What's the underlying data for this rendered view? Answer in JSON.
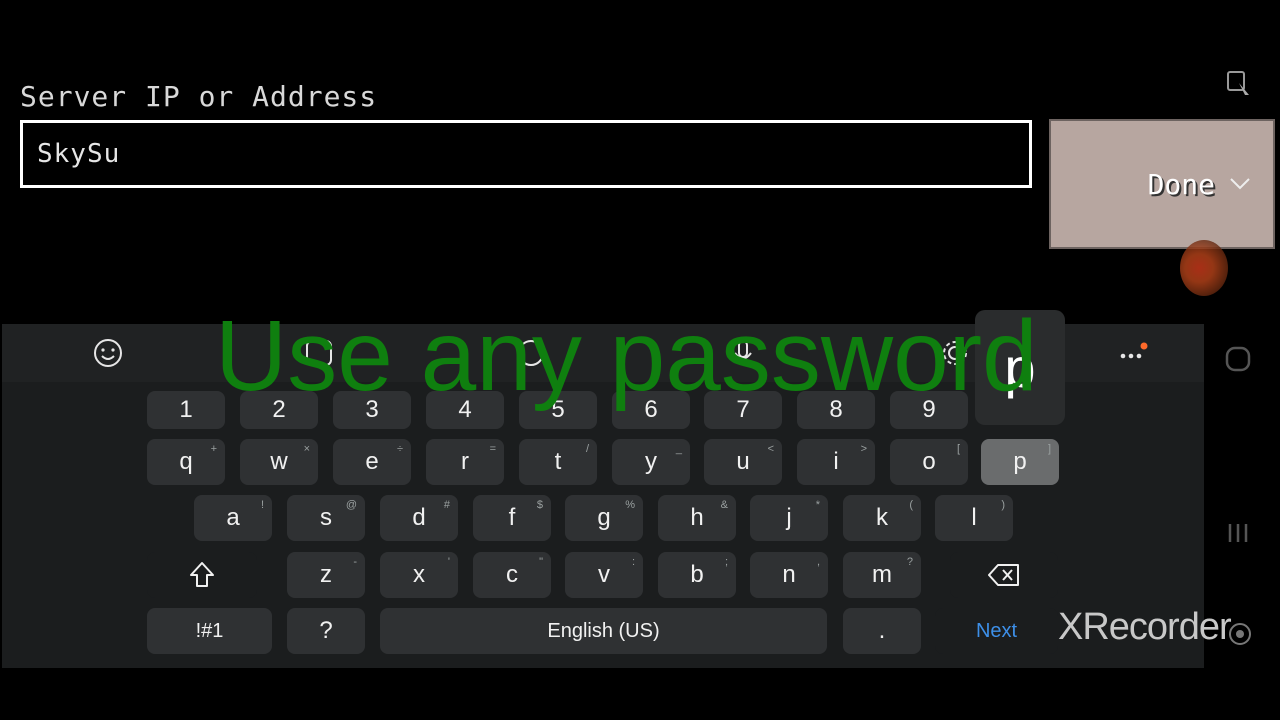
{
  "form": {
    "label": "Server IP or Address",
    "input_value": "SkySu",
    "done_label": "Done"
  },
  "overlay": {
    "caption": "Use any password",
    "preview_key": "p"
  },
  "watermark": "XRecorder",
  "keyboard": {
    "language": "English (US)",
    "next_label": "Next",
    "symbols_label": "!#1",
    "question_label": "?",
    "period_label": ".",
    "rows": {
      "numbers": [
        "1",
        "2",
        "3",
        "4",
        "5",
        "6",
        "7",
        "8",
        "9"
      ],
      "top": [
        {
          "k": "q",
          "a": "+"
        },
        {
          "k": "w",
          "a": "×"
        },
        {
          "k": "e",
          "a": "÷"
        },
        {
          "k": "r",
          "a": "="
        },
        {
          "k": "t",
          "a": "/"
        },
        {
          "k": "y",
          "a": "_"
        },
        {
          "k": "u",
          "a": "<"
        },
        {
          "k": "i",
          "a": ">"
        },
        {
          "k": "o",
          "a": "["
        },
        {
          "k": "p",
          "a": "]"
        }
      ],
      "middle": [
        {
          "k": "a",
          "a": "!"
        },
        {
          "k": "s",
          "a": "@"
        },
        {
          "k": "d",
          "a": "#"
        },
        {
          "k": "f",
          "a": "$"
        },
        {
          "k": "g",
          "a": "%"
        },
        {
          "k": "h",
          "a": "&"
        },
        {
          "k": "j",
          "a": "*"
        },
        {
          "k": "k",
          "a": "("
        },
        {
          "k": "l",
          "a": ")"
        }
      ],
      "bottom": [
        {
          "k": "z",
          "a": "-"
        },
        {
          "k": "x",
          "a": "'"
        },
        {
          "k": "c",
          "a": "\""
        },
        {
          "k": "v",
          "a": ":"
        },
        {
          "k": "b",
          "a": ";"
        },
        {
          "k": "n",
          "a": ","
        },
        {
          "k": "m",
          "a": "?"
        }
      ]
    },
    "active_key": "p"
  },
  "colors": {
    "caption": "#0f7f0f",
    "done_bg": "#b7a6a0",
    "next": "#3d8fe8",
    "keyboard_bg": "#1b1d1e",
    "key_bg": "#2f3133"
  }
}
